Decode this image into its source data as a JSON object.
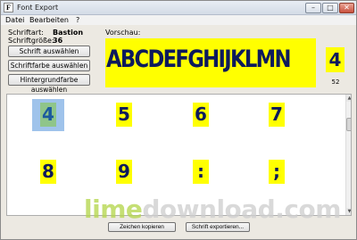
{
  "window": {
    "title": "Font Export"
  },
  "titlebar_buttons": {
    "minimize": "–",
    "maximize": "□",
    "close": "✕"
  },
  "menu": [
    "Datei",
    "Bearbeiten",
    "?"
  ],
  "font_info": {
    "font_label": "Schriftart:",
    "font_value": "Bastion",
    "size_label": "Schriftgröße:",
    "size_value": "36"
  },
  "buttons": {
    "choose_font": "Schrift auswählen",
    "choose_font_color": "Schriftfarbe auswählen",
    "choose_bg_color": "Hintergrundfarbe auswählen"
  },
  "preview": {
    "label": "Vorschau:",
    "text": "ABCDEFGHIJKLMN",
    "selected_char": "4",
    "selected_code": "52"
  },
  "glyphs": [
    "4",
    "5",
    "6",
    "7",
    "8",
    "9",
    ":",
    ";"
  ],
  "selected_glyph": "4",
  "scrollbar": {
    "up_arrow": "▲",
    "down_arrow": "▼"
  },
  "bottom_buttons": {
    "copy_chars": "Zeichen kopieren",
    "export_font": "Schrift exportieren..."
  },
  "watermark": {
    "part1": "lime",
    "part2": "download.com"
  },
  "colors": {
    "glyph_background": "#ffff00",
    "glyph_color": "#0d1a5c",
    "selection_highlight": "#9fc3eb"
  },
  "icons": {
    "app_icon": "font-app-icon",
    "minimize": "minimize-icon",
    "maximize": "maximize-icon",
    "close": "close-icon"
  }
}
